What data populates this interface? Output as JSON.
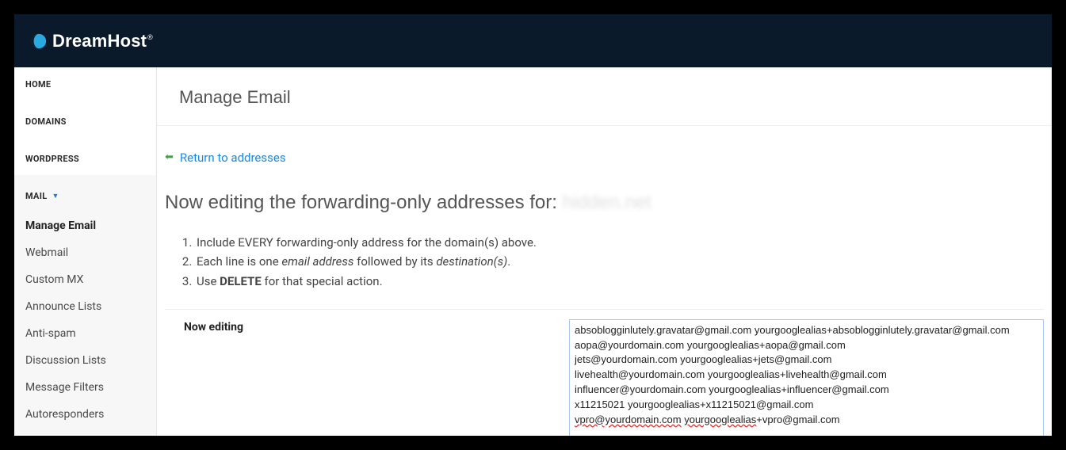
{
  "brand": "DreamHost",
  "sidebar": {
    "home": "HOME",
    "domains": "DOMAINS",
    "wordpress": "WORDPRESS",
    "mail": "MAIL",
    "items": [
      "Manage Email",
      "Webmail",
      "Custom MX",
      "Announce Lists",
      "Anti-spam",
      "Discussion Lists",
      "Message Filters",
      "Autoresponders"
    ]
  },
  "page": {
    "title": "Manage Email",
    "return_link": "Return to addresses",
    "heading_prefix": "Now editing the forwarding-only addresses for:",
    "heading_domain_blurred": "hidden.net",
    "instructions": {
      "li1_a": "Include EVERY forwarding-only address for the domain(s) above.",
      "li2_a": "Each line is one ",
      "li2_em1": "email address",
      "li2_b": " followed by its ",
      "li2_em2": "destination(s)",
      "li2_c": ".",
      "li3_a": "Use ",
      "li3_strong": "DELETE",
      "li3_b": " for that special action."
    },
    "edit_label": "Now editing",
    "edit_lines": [
      "absoblogginlutely.gravatar@gmail.com yourgooglealias+absoblogginlutely.gravatar@gmail.com",
      "aopa@yourdomain.com yourgooglealias+aopa@gmail.com",
      "jets@yourdomain.com yourgooglealias+jets@gmail.com",
      "livehealth@yourdomain.com yourgooglealias+livehealth@gmail.com",
      "influencer@yourdomain.com yourgooglealias+influencer@gmail.com",
      "x11215021 yourgooglealias+x11215021@gmail.com",
      "vpro@yourdomain.com yourgooglealias+vpro@gmail.com"
    ]
  }
}
